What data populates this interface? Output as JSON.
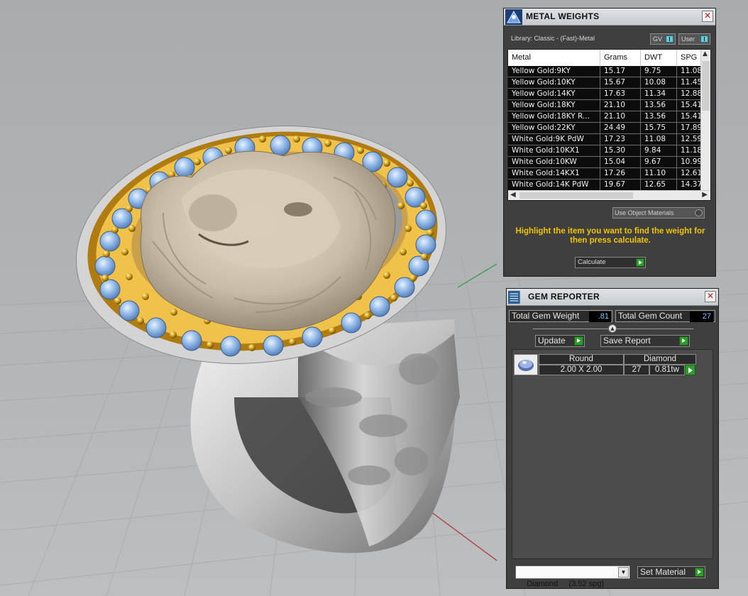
{
  "metal_weights": {
    "title": "METAL WEIGHTS",
    "library": "Library: Classic - (Fast)-Metal",
    "toggle_gv": "GV",
    "toggle_user": "User",
    "columns": [
      "Metal",
      "Grams",
      "DWT",
      "SPG"
    ],
    "rows": [
      {
        "metal": "Yellow Gold:9KY",
        "grams": "15.17",
        "dwt": "9.75",
        "spg": "11.08"
      },
      {
        "metal": "Yellow Gold:10KY",
        "grams": "15.67",
        "dwt": "10.08",
        "spg": "11.45"
      },
      {
        "metal": "Yellow Gold:14KY",
        "grams": "17.63",
        "dwt": "11.34",
        "spg": "12.88"
      },
      {
        "metal": "Yellow Gold:18KY",
        "grams": "21.10",
        "dwt": "13.56",
        "spg": "15.41"
      },
      {
        "metal": "Yellow Gold:18KY R...",
        "grams": "21.10",
        "dwt": "13.56",
        "spg": "15.41"
      },
      {
        "metal": "Yellow Gold:22KY",
        "grams": "24.49",
        "dwt": "15.75",
        "spg": "17.89"
      },
      {
        "metal": "White Gold:9K PdW",
        "grams": "17.23",
        "dwt": "11.08",
        "spg": "12.59"
      },
      {
        "metal": "White Gold:10KX1",
        "grams": "15.30",
        "dwt": "9.84",
        "spg": "11.18"
      },
      {
        "metal": "White Gold:10KW",
        "grams": "15.04",
        "dwt": "9.67",
        "spg": "10.99"
      },
      {
        "metal": "White Gold:14KX1",
        "grams": "17.26",
        "dwt": "11.10",
        "spg": "12.61"
      },
      {
        "metal": "White Gold:14K PdW",
        "grams": "19.67",
        "dwt": "12.65",
        "spg": "14.37"
      }
    ],
    "use_object_materials": "Use Object Materials",
    "instruction": "Highlight the item you want to find the weight for then press calculate.",
    "calculate": "Calculate",
    "colors": {
      "instruction": "#f1c400",
      "accent_green": "#2f9b2c",
      "toggle": "#67c9d8"
    }
  },
  "gem_reporter": {
    "title": "GEM REPORTER",
    "total_weight_label": "Total Gem Weight",
    "total_weight_value": ".81",
    "total_count_label": "Total Gem Count",
    "total_count_value": "27",
    "update": "Update",
    "save_report": "Save Report",
    "gem": {
      "shape": "Round",
      "material": "Diamond",
      "size": "2.00 X 2.00",
      "count": "27",
      "weight": "0.81tw"
    },
    "material_select": "Diamond     (3.52 spg)",
    "set_material": "Set Material",
    "colors": {
      "value_text": "#7ec3ff"
    }
  }
}
